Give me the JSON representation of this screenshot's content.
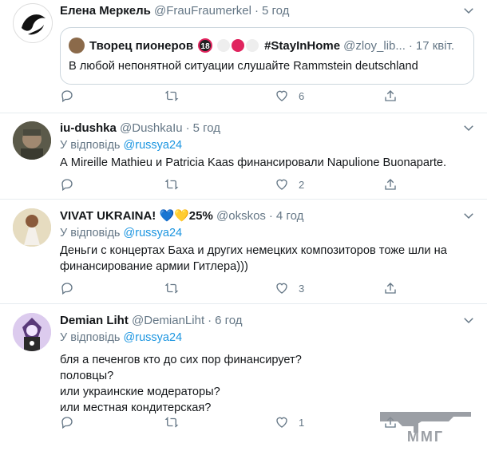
{
  "tweets": [
    {
      "name": "Елена Меркель",
      "handle": "@FrauFraumerkel",
      "time": "5 год",
      "quote": {
        "name": "Творец пионеров",
        "badge": "18",
        "hashtag": "#StayInHome",
        "handle": "@zloy_lib...",
        "time": "17 квіт.",
        "text": "В любой непонятной ситуации слушайте Rammstein deutschland"
      },
      "likes": "6"
    },
    {
      "name": "iu-dushka",
      "handle": "@DushkaIu",
      "time": "5 год",
      "reply_prefix": "У відповідь",
      "reply_to": "@russya24",
      "text": "А Mireille Mathieu и Patricia Kaas финансировали Napulione Buonaparte.",
      "likes": "2"
    },
    {
      "name": "VIVAT UKRAINA! 💙💛25%",
      "handle": "@okskos",
      "time": "4 год",
      "reply_prefix": "У відповідь",
      "reply_to": "@russya24",
      "text": "Деньги с концертах Баха и других немецких композиторов тоже шли на финансирование армии Гитлера)))",
      "likes": "3"
    },
    {
      "name": "Demian Liht",
      "handle": "@DemianLiht",
      "time": "6 год",
      "reply_prefix": "У відповідь",
      "reply_to": "@russya24",
      "lines": [
        "бля а печенгов кто до сих пор финансирует?",
        "половцы?",
        "или украинские модераторы?",
        "или местная кондитерская?"
      ],
      "likes": "1"
    }
  ],
  "watermark": {
    "text": "MMГ"
  },
  "colors": {
    "link": "#1b95e0",
    "secondary": "#657786",
    "border": "#e6ecf0"
  }
}
